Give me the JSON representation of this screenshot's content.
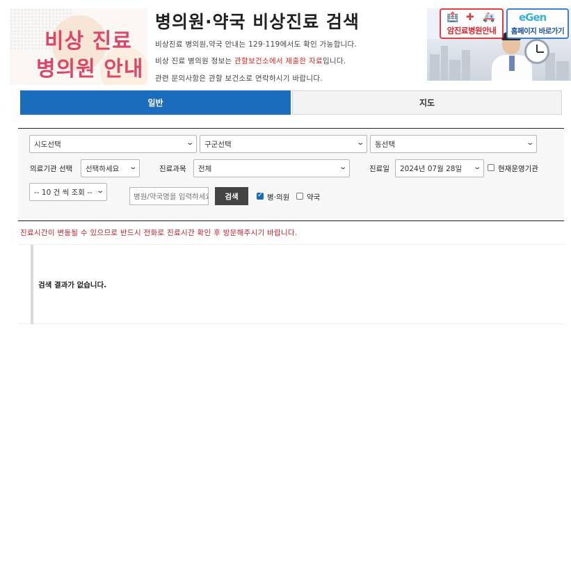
{
  "header": {
    "logo_line1": "비상 진료",
    "logo_line2": "병의원 안내",
    "title": "병의원·약국 비상진료 검색",
    "desc1": "비상진료 병의원,약국 안내는 129·119에서도 확인 가능합니다.",
    "desc2_pre": "비상 진료 병의원 정보는 ",
    "desc2_highlight": "관할보건소에서 제출한 자료",
    "desc2_post": "입니다.",
    "desc3": "관련 문의사항은 관할 보건소로 연락하시기 바랍니다.",
    "banner_cancer_label": "암진료병원안내",
    "banner_eco_logo": "eGen",
    "banner_home_label": "홈페이지 바로가기"
  },
  "tabs": [
    {
      "label": "일반",
      "active": true
    },
    {
      "label": "지도",
      "active": false
    }
  ],
  "filters": {
    "sido": "시도선택",
    "gugun": "구군선택",
    "dong": "동선택",
    "institution_label": "의료기관 선택",
    "institution_value": "선택하세요",
    "department_label": "진료과목",
    "department_value": "전체",
    "date_label": "진료일",
    "date_value": "2024년 07월 28일",
    "open_now_label": "현재운영기관",
    "open_now_checked": false,
    "page_size": "-- 10 건 씩 조회 --",
    "search_placeholder": "병원/약국명을 입력하세요",
    "search_button": "검색",
    "hospital_label": "병·의원",
    "hospital_checked": true,
    "pharmacy_label": "약국",
    "pharmacy_checked": false
  },
  "notice": "진료시간이 변동될 수 있으므로 반드시 전화로 진료시간 확인 후 방문해주시기 바랍니다.",
  "result": {
    "empty_message": "검색 결과가 없습니다."
  },
  "colors": {
    "primary": "#1a6cbd",
    "notice": "#c8202a",
    "logo": "#d9476b",
    "highlight": "#d8261e"
  }
}
